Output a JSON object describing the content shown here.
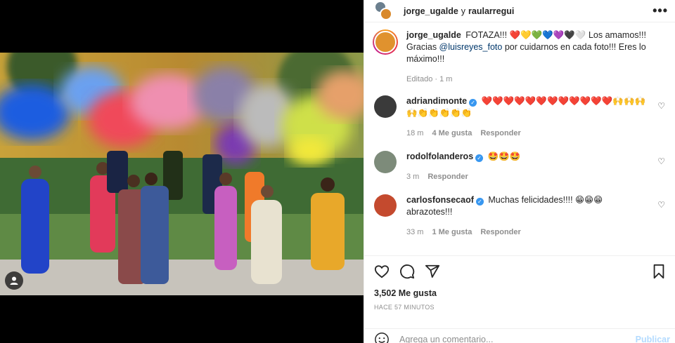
{
  "header": {
    "user1": "jorge_ugalde",
    "connector": "y",
    "user2": "raularregui",
    "more_icon": "more-horizontal-icon"
  },
  "caption": {
    "username": "jorge_ugalde",
    "text_start": "FOTAZA!!! ❤️💛💚💙💜🖤🤍 Los amamos!!! Gracias ",
    "mention": "@luisreyes_foto",
    "text_end": " por cuidarnos en cada foto!!! Eres lo máximo!!!",
    "meta": "Editado · 1 m"
  },
  "comments": [
    {
      "username": "adriandimonte",
      "verified": true,
      "text": "❤️❤️❤️❤️❤️❤️❤️❤️❤️❤️❤️❤️🙌🙌🙌🙌👏👏👏👏👏",
      "time": "18 m",
      "likes": "4 Me gusta",
      "reply": "Responder",
      "avatar_color": "#3a3a3a"
    },
    {
      "username": "rodolfolanderos",
      "verified": true,
      "text": "🤩🤩🤩",
      "time": "3 m",
      "likes": "",
      "reply": "Responder",
      "avatar_color": "#7d8b7a"
    },
    {
      "username": "carlosfonsecaof",
      "verified": true,
      "text": "Muchas felicidades!!!! 😁😁😁abrazotes!!!",
      "time": "33 m",
      "likes": "1 Me gusta",
      "reply": "Responder",
      "avatar_color": "#c44a2e"
    }
  ],
  "actions": {
    "like_icon": "heart-icon",
    "comment_icon": "comment-icon",
    "share_icon": "share-icon",
    "save_icon": "bookmark-icon"
  },
  "likes": "3,502 Me gusta",
  "posted_ago": "HACE 57 MINUTOS",
  "add_comment": {
    "placeholder": "Agrega un comentario...",
    "publish": "Publicar"
  },
  "colors": {
    "link": "#00376b",
    "verified": "#3897f0",
    "publish_disabled": "#b3dbff"
  }
}
